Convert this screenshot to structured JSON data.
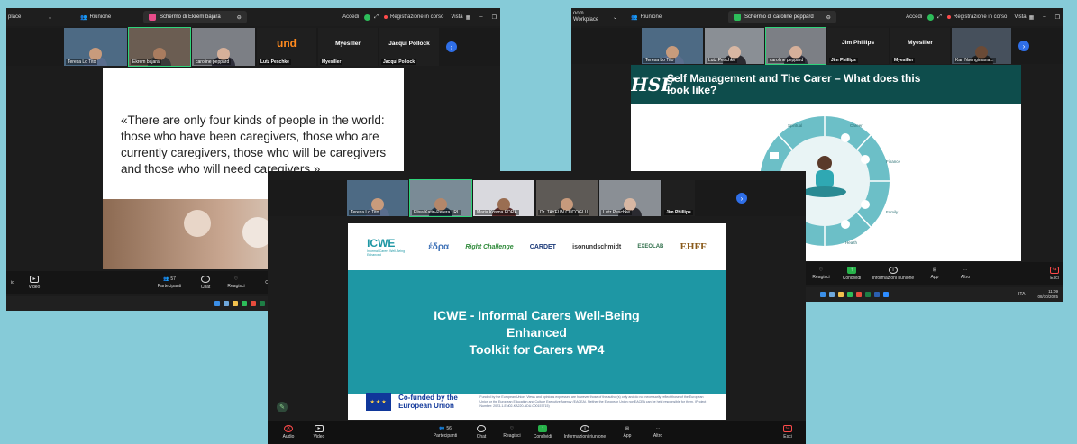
{
  "shot_left": {
    "top_bar": {
      "app": "place",
      "meeting": "Riunione",
      "screen_tab": "Schermo di Ekrem bajara",
      "sign_in": "Accedi",
      "recording": "Registrazione in corso",
      "view": "Vista"
    },
    "participants": [
      "Teresa Lo Tito",
      "Ekrem bajara",
      "caroline peppard",
      "Lutz Peschke",
      "Myesiller",
      "Jacqui Pollock"
    ],
    "participant_tiles": {
      "lutz_logo": "und",
      "myesiller": "Myesiller",
      "jacqui": "Jacqui Pollock"
    },
    "slide_quote": "«There are only four kinds of people in the world: those who have been caregivers, those who are currently caregivers, those who will be caregivers and those who will need caregivers.»",
    "toolbar": {
      "audio": "io",
      "video": "Video",
      "participants": "Partecipanti",
      "participants_count": "57",
      "chat": "Chat",
      "reactions": "Reagisci",
      "share": "C"
    }
  },
  "shot_right": {
    "top_bar": {
      "app": "Workplace",
      "app_top": "oom",
      "meeting": "Riunione",
      "screen_tab": "Schermo di caroline peppard",
      "sign_in": "Accedi",
      "recording": "Registrazione in corso",
      "view": "Vista"
    },
    "participants": [
      "Teresa Lo Tito",
      "Lutz Peschke",
      "caroline peppard",
      "Jim Phillips",
      "Myesiller",
      "Karl Nsengimana..."
    ],
    "participant_tiles": {
      "jim": "Jim Phillips",
      "myesiller": "Myesiller"
    },
    "slide": {
      "logo": "HSE",
      "title": "Self Management and The Carer – What does this look like?",
      "wheel_labels": [
        "Spiritual",
        "Career",
        "Finance",
        "Family",
        "Health"
      ]
    },
    "toolbar": {
      "reactions": "Reagisci",
      "share": "Condividi",
      "info": "Informazioni riunione",
      "apps": "App",
      "more": "Altro",
      "leave": "Esci"
    },
    "taskbar": {
      "lang": "ITA",
      "time": "11:09",
      "date": "08/10/2025"
    }
  },
  "shot_center": {
    "participants": [
      "Teresa Lo Tito",
      "Elisa Katin-Perera | RL",
      "Maria Kosma EDRA",
      "Dr. TAYFUN CUCOGLU",
      "Lutz Peschke",
      "Jim Phillips"
    ],
    "participant_tiles": {
      "jim": "Jim Phillips"
    },
    "slide": {
      "logos": {
        "icwe": "ICWE",
        "icwe_sub": "Informal Carers Well-Being Enhanced",
        "edra": "έδρα",
        "rightchallenge": "Right Challenge",
        "cardet": "CARDET",
        "ison": "isonundschmidt",
        "exeolab": "EXEOLAB",
        "ehff": "EHFF"
      },
      "title_line1": "ICWE - Informal Carers Well-Being",
      "title_line2": "Enhanced",
      "title_line3": "Toolkit for Carers WP4",
      "eu_funding": "Co-funded by the European Union",
      "disclaimer": "Funded by the European Union. Views and opinions expressed are however those of the author(s) only and do not necessarily reflect those of the European Union or the European Education and Culture Executive Agency (EACEA). Neither the European Union nor EACEA can be held responsible for them. (Project Number: 2023-1-EN02-KA220-ADU-000157715)"
    },
    "toolbar": {
      "audio": "Audio",
      "video": "Video",
      "participants": "Partecipanti",
      "participants_count": "56",
      "chat": "Chat",
      "reactions": "Reagisci",
      "share": "Condividi",
      "info": "Informazioni riunione",
      "apps": "App",
      "more": "Altro",
      "leave": "Esci"
    }
  },
  "colors": {
    "background": "#86cbd8",
    "teal_band": "#1e97a4",
    "hse_green": "#0e4d4c",
    "share_green": "#27b24a",
    "leave_red": "#ff4b4b"
  }
}
